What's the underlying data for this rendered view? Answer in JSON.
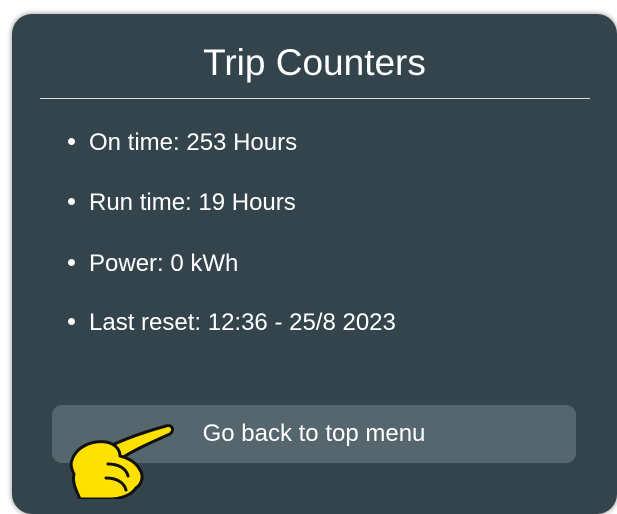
{
  "panel": {
    "title": "Trip Counters"
  },
  "stats": [
    {
      "text": "On time: 253 Hours"
    },
    {
      "text": "Run time: 19 Hours"
    },
    {
      "text": "Power: 0 kWh"
    },
    {
      "text": "Last reset: 12:36 - 25/8 2023"
    }
  ],
  "actions": {
    "back_label": "Go back to top menu"
  },
  "pointer": {
    "icon": "pointing-hand-icon",
    "color": "#ffe100"
  },
  "colors": {
    "panel_background": "#34444c",
    "button_background": "#56666e",
    "text": "#ffffff"
  }
}
